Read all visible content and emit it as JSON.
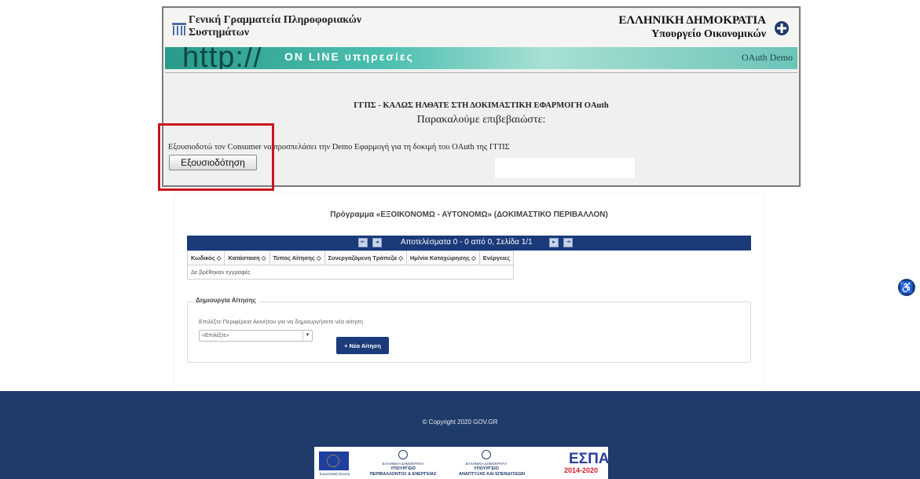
{
  "oauth": {
    "org_name": "Γενική Γραμματεία Πληροφοριακών Συστημάτων",
    "state_title": "ΕΛΛΗΝΙΚΗ ΔΗΜΟΚΡΑΤΙΑ",
    "ministry": "Υπουργείο Οικονομικών",
    "banner_http": "http://",
    "banner_online": "ON LINE υπηρεσίες",
    "banner_right": "OAuth Demo",
    "welcome_title": "ΓΓΠΣ - ΚΑΛΩΣ ΗΛΘΑΤΕ ΣΤΗ ΔΟΚΙΜΑΣΤΙΚΗ ΕΦΑΡΜΟΓΗ OAuth",
    "confirm_text": "Παρακαλούμε επιβεβαιώστε:",
    "authorize_text": "Εξουσιοδοτώ τον Consumer να προσπελάσει την Demo Εφαρμογή για τη δοκιμή του OAuth της ΓΓΠΣ",
    "authorize_button": "Εξουσιοδότηση"
  },
  "program": {
    "title": "Πρόγραμμα «ΕΞΟΙΚΟΝΟΜΩ - ΑΥΤΟΝΟΜΩ» (ΔΟΚΙΜΑΣΤΙΚΟ ΠΕΡΙΒΑΛΛΟΝ)"
  },
  "grid": {
    "results_label": "Αποτελέσματα 0 - 0 από 0, Σελίδα 1/1",
    "pager": {
      "first": "⇤",
      "prev": "◂",
      "next": "▸",
      "last": "⇥"
    },
    "columns": [
      "Κωδικός ◇",
      "Κατάσταση ◇",
      "Τύπος Αίτησης ◇",
      "Συνεργαζόμενη Τράπεζα ◇",
      "Ημ/νία Καταχώρησης ◇",
      "Ενέργειες"
    ],
    "empty_message": "Δε βρέθηκαν εγγραφές"
  },
  "create": {
    "legend": "Δημιουργία Αίτησης",
    "hint": "Επιλέξτε Περιφέρεια Ακινήτου για να δημιουργήσετε νέα αίτηση",
    "select_value": "«Επιλέξτε»",
    "new_button": "+ Νέα Αίτηση"
  },
  "footer": {
    "copyright": "© Copyright 2020 GOV.GR",
    "eu_label": "Ευρωπαϊκή Ένωση",
    "ministry_env_state": "ΕΛΛΗΝΙΚΗ ΔΗΜΟΚΡΑΤΙΑ",
    "ministry_env_1": "ΥΠΟΥΡΓΕΙΟ",
    "ministry_env_2": "ΠΕΡΙΒΑΛΛΟΝΤΟΣ & ΕΝΕΡΓΕΙΑΣ",
    "ministry_dev_state": "ΕΛΛΗΝΙΚΗ ΔΗΜΟΚΡΑΤΙΑ",
    "ministry_dev_1": "ΥΠΟΥΡΓΕΙΟ",
    "ministry_dev_2": "ΑΝΑΠΤΥΞΗΣ ΚΑΙ ΕΠΕΝΔΥΣΕΩΝ",
    "espa": "ΕΣΠΑ",
    "espa_years": "2014-2020"
  },
  "colors": {
    "accent": "#1b3b7a",
    "footer_bg": "#1e3b6a",
    "highlight": "#c8141e"
  }
}
